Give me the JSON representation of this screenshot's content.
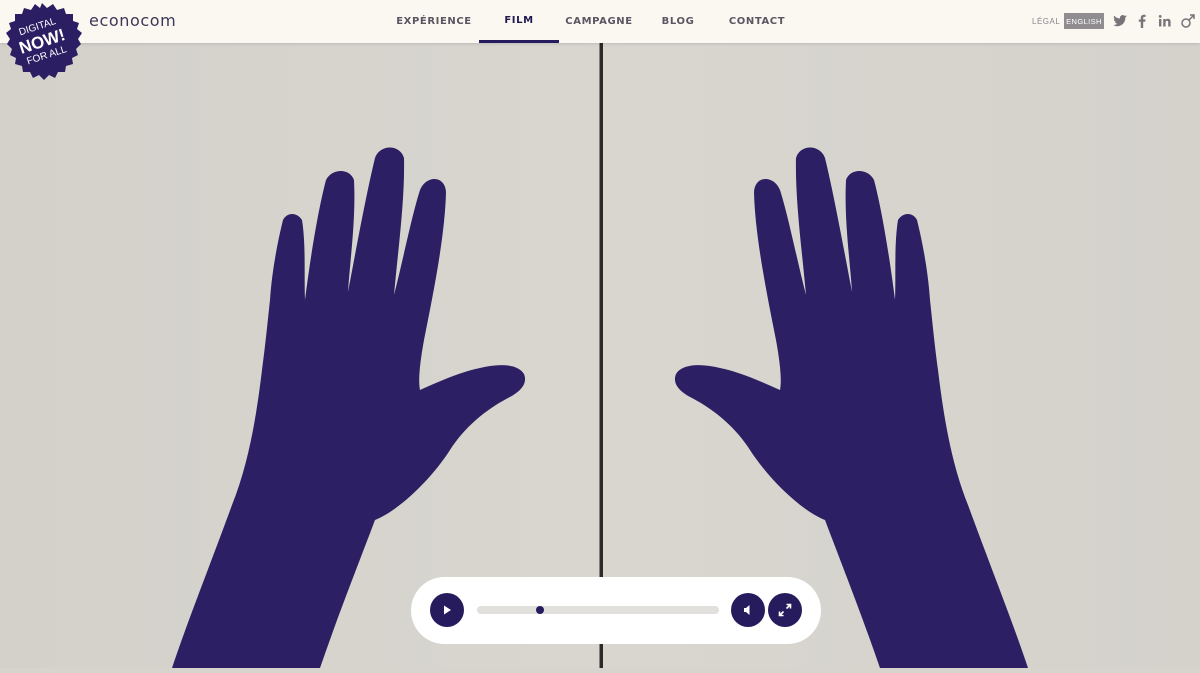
{
  "badge": {
    "line1": "DIGITAL",
    "line2": "NOW!",
    "line3": "FOR ALL"
  },
  "brand": {
    "name": "econocom"
  },
  "nav": {
    "items": [
      {
        "label": "EXPÉRIENCE",
        "active": false
      },
      {
        "label": "FILM",
        "active": true
      },
      {
        "label": "CAMPAGNE",
        "active": false
      },
      {
        "label": "BLOG",
        "active": false
      },
      {
        "label": "CONTACT",
        "active": false
      }
    ]
  },
  "utility": {
    "legal": "LÉGAL",
    "language": "ENGLISH"
  },
  "social": [
    "twitter-icon",
    "facebook-icon",
    "linkedin-icon",
    "gender-icon"
  ],
  "player": {
    "progress": 0.25
  },
  "colors": {
    "accent": "#251b5d",
    "header_bg": "#fbf7f1",
    "stage_bg": "#d6d4cd",
    "hand": "#2c1f63"
  }
}
